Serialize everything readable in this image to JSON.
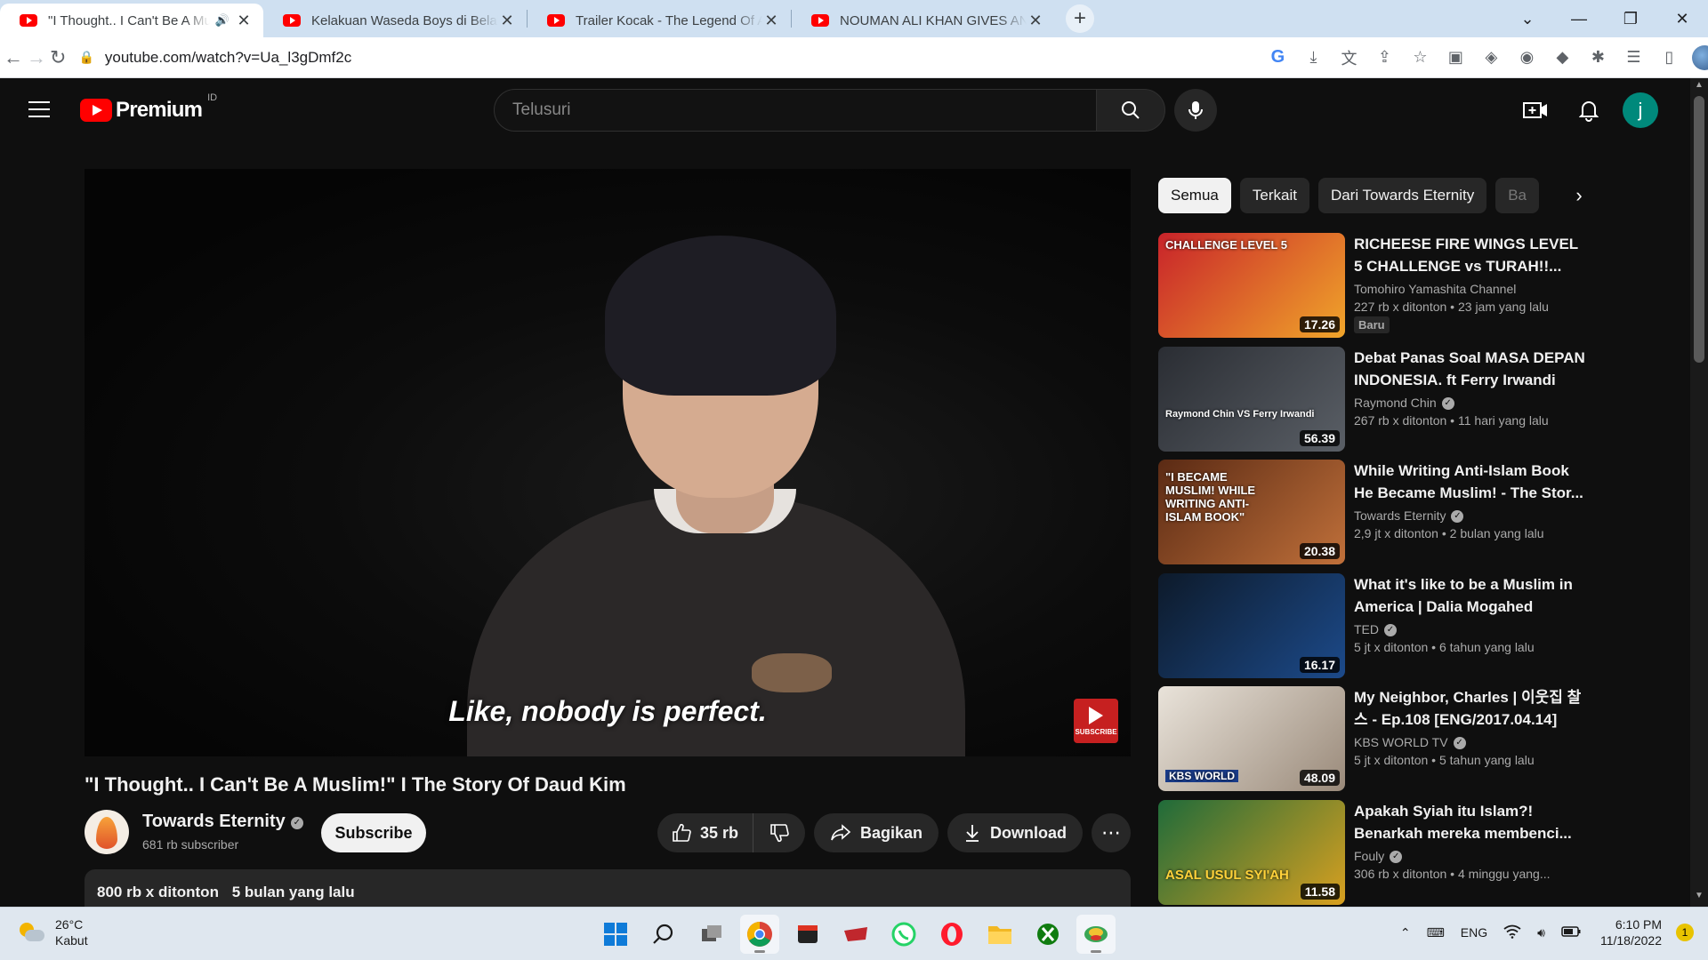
{
  "browser": {
    "tabs": [
      {
        "title": "\"I Thought.. I Can't Be A Muslim!\" I The Story Of Daud Kim",
        "active": true,
        "audio": true
      },
      {
        "title": "Kelakuan Waseda Boys di Belakang Layar",
        "active": false
      },
      {
        "title": "Trailer Kocak - The Legend Of Aliando",
        "active": false
      },
      {
        "title": "NOUMAN ALI KHAN GIVES AND SAYS",
        "active": false
      }
    ],
    "url": "youtube.com/watch?v=Ua_l3gDmf2c"
  },
  "youtube": {
    "logo_text": "Premium",
    "country_code": "ID",
    "search_placeholder": "Telusuri",
    "user_initial": "j",
    "accent_color": "#ff0000"
  },
  "video": {
    "subtitle": "Like, nobody is perfect.",
    "subscribe_watermark": "SUBSCRIBE",
    "title": "\"I Thought.. I Can't Be A Muslim!\" I The Story Of Daud Kim",
    "channel": "Towards Eternity",
    "subscribers": "681 rb subscriber",
    "subscribe_label": "Subscribe",
    "likes": "35 rb",
    "share_label": "Bagikan",
    "download_label": "Download",
    "views": "800 rb x ditonton",
    "uploaded": "5 bulan yang lalu"
  },
  "chips": [
    "Semua",
    "Terkait",
    "Dari Towards Eternity",
    "Ba"
  ],
  "recommendations": [
    {
      "title": "RICHEESE FIRE WINGS LEVEL 5 CHALLENGE vs TURAH!!...",
      "channel": "Tomohiro Yamashita Channel",
      "verified": false,
      "views": "227 rb x ditonton",
      "age": "23 jam yang lalu",
      "duration": "17.26",
      "badge": "Baru",
      "thumb_text": "CHALLENGE LEVEL 5",
      "thumb_colors": [
        "#c8232a",
        "#f0a52a"
      ]
    },
    {
      "title": "Debat Panas Soal MASA DEPAN INDONESIA. ft Ferry Irwandi",
      "channel": "Raymond Chin",
      "verified": true,
      "views": "267 rb x ditonton",
      "age": "11 hari yang lalu",
      "duration": "56.39",
      "thumb_text": "Raymond Chin VS Ferry Irwandi",
      "thumb_colors": [
        "#2a2d33",
        "#5a5f66"
      ]
    },
    {
      "title": "While Writing Anti-Islam Book He Became Muslim! - The Stor...",
      "channel": "Towards Eternity",
      "verified": true,
      "views": "2,9 jt x ditonton",
      "age": "2 bulan yang lalu",
      "duration": "20.38",
      "thumb_text": "\"I BECAME MUSLIM! WHILE WRITING ANTI-ISLAM BOOK\"",
      "thumb_colors": [
        "#5a2a14",
        "#c0703a"
      ]
    },
    {
      "title": "What it's like to be a Muslim in America | Dalia Mogahed",
      "channel": "TED",
      "verified": true,
      "views": "5 jt x ditonton",
      "age": "6 tahun yang lalu",
      "duration": "16.17",
      "thumb_text": "",
      "thumb_colors": [
        "#0d1a2a",
        "#1c4a8a"
      ]
    },
    {
      "title": "My Neighbor, Charles | 이웃집 찰스 - Ep.108 [ENG/2017.04.14]",
      "channel": "KBS WORLD TV",
      "verified": true,
      "views": "5 jt x ditonton",
      "age": "5 tahun yang lalu",
      "duration": "48.09",
      "thumb_text": "KBS WORLD",
      "thumb_colors": [
        "#e9e3da",
        "#9a8a7a"
      ]
    },
    {
      "title": "Apakah Syiah itu Islam?! Benarkah mereka membenci...",
      "channel": "Fouly",
      "verified": true,
      "views": "306 rb x ditonton",
      "age": "4 minggu yang...",
      "duration": "11.58",
      "thumb_text": "ASAL USUL SYI'AH",
      "thumb_colors": [
        "#1f6b3a",
        "#d8a020"
      ]
    }
  ],
  "taskbar": {
    "temperature": "26°C",
    "condition": "Kabut",
    "language": "ENG",
    "time": "6:10 PM",
    "date": "11/18/2022",
    "notification_count": "1"
  }
}
